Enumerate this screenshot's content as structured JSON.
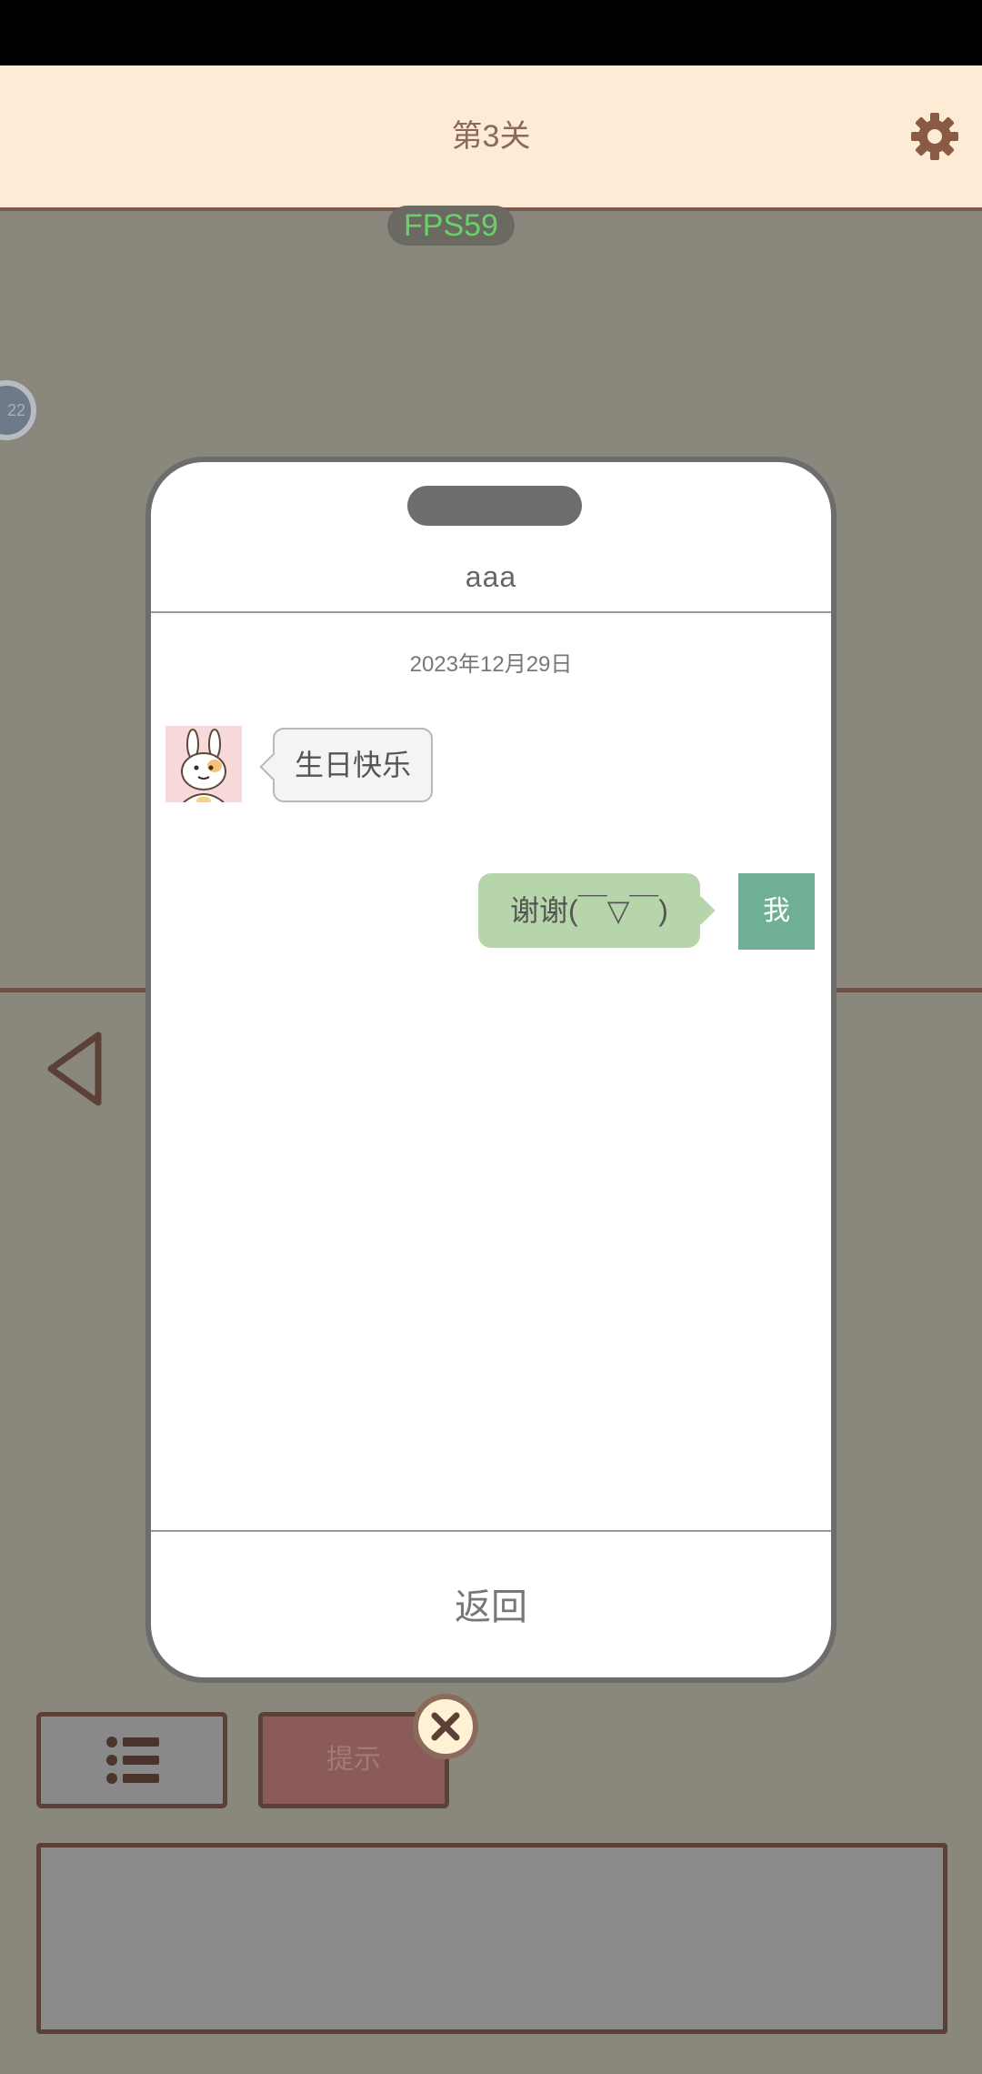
{
  "header": {
    "level_title": "第3关"
  },
  "overlay": {
    "fps": "FPS59",
    "badge_text": "22"
  },
  "chat": {
    "contact_name": "aaa",
    "date": "2023年12月29日",
    "messages": [
      {
        "from": "contact",
        "text": "生日快乐"
      },
      {
        "from": "me",
        "text": "谢谢(￣▽￣)",
        "avatar_label": "我"
      }
    ],
    "return_label": "返回"
  },
  "footer": {
    "hint_label": "提示"
  },
  "icons": {
    "settings": "gear-icon",
    "back": "back-arrow-icon",
    "list": "list-icon",
    "close": "close-icon"
  },
  "colors": {
    "topbar_bg": "#fdebd6",
    "background": "#8a877c",
    "me_bubble": "#b7d5aa",
    "me_avatar": "#6fb094",
    "fps_text": "#6ad06a"
  }
}
